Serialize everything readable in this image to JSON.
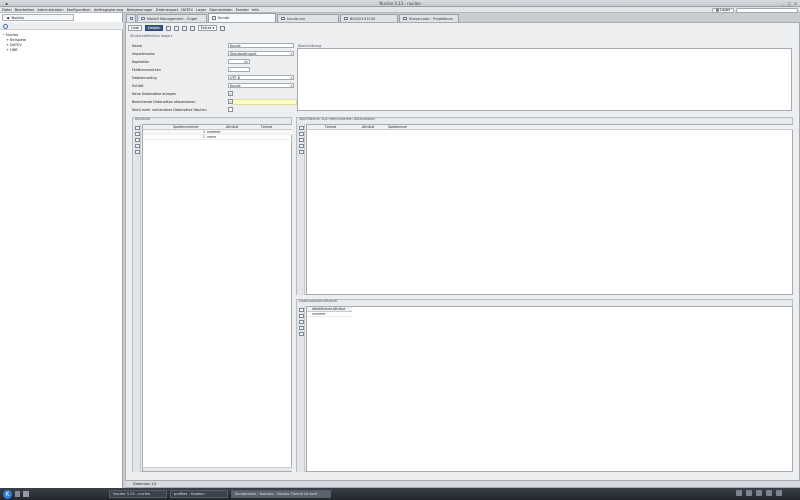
{
  "window": {
    "title": "Nucleo 3.13 - nucleo",
    "controls": [
      "_",
      "□",
      "×"
    ]
  },
  "menu": [
    "Datei",
    "Bearbeiten",
    "Administration",
    "Konfiguration",
    "Auftragsplanung",
    "Belegmanager",
    "Datenexport",
    "DATEV",
    "Lager",
    "Stammdaten",
    "Fenster",
    "Info"
  ],
  "lager_button": "Lager",
  "left_pane": {
    "tab_label": "Nucleo",
    "tree": [
      {
        "label": "Nucleo",
        "level": 0,
        "expander": "−"
      },
      {
        "label": "Beispiele",
        "level": 1,
        "expander": "+"
      },
      {
        "label": "DATEV",
        "level": 1,
        "expander": "+"
      },
      {
        "label": "HBR",
        "level": 1,
        "expander": "+"
      }
    ]
  },
  "tabs": [
    {
      "label": "",
      "active": false
    },
    {
      "label": "Modell Management - Engel",
      "active": false
    },
    {
      "label": "Kunde",
      "active": true
    },
    {
      "label": "kunde.csv",
      "active": false
    },
    {
      "label": "80020191230",
      "active": false
    },
    {
      "label": "Steuercode - Projektions",
      "active": false
    }
  ],
  "toolbar": {
    "btn_liste": "Liste",
    "btn_details": "Details",
    "extras": "Extras ▾"
  },
  "section_title": "Strukturdefinition Import",
  "form": [
    {
      "label": "Name",
      "value": "Kunde",
      "type": "text"
    },
    {
      "label": "Importmodus",
      "value": "Standardimport",
      "type": "select"
    },
    {
      "label": "Kopfzeilen",
      "value": "1",
      "type": "spin"
    },
    {
      "label": "Feldtrennzeichen",
      "value": ";",
      "type": "small"
    },
    {
      "label": "Dateiencoding",
      "value": "UTF-8",
      "type": "select"
    },
    {
      "label": "Entität",
      "value": "Kunde",
      "type": "select"
    },
    {
      "label": "Neue Datensätze anlegen",
      "value": "✓",
      "type": "check"
    },
    {
      "label": "Bestehende Datensätze aktualisieren",
      "value": "✓",
      "type": "check"
    },
    {
      "label": "Nicht mehr vorhandene Datensätze löschen",
      "value": "",
      "type": "check"
    }
  ],
  "beschreibung_title": "Beschreibung",
  "attribute": {
    "title": "Attribute",
    "columns": [
      "Spaltennummer",
      "Attribut",
      "Format"
    ],
    "rows": [
      {
        "nr": "1",
        "attr": "nummer",
        "fmt": ""
      },
      {
        "nr": "2",
        "attr": "name",
        "fmt": ""
      }
    ]
  },
  "identifiers": {
    "title": "Identifizierer aus referenzierten Datensätzen",
    "columns": [
      "Format",
      "Attribut",
      "Spaltennum"
    ]
  },
  "datensatz": {
    "title": "Datensatzidentifizierer",
    "columns": [
      "Identifizierer-Attribut"
    ],
    "rows": [
      "nummer"
    ]
  },
  "status": "Datensatz 1/1",
  "taskbar": {
    "tasks": [
      {
        "label": "Nucleo 3.13 - nucleo",
        "active": false
      },
      {
        "label": "profiles - Dolphin",
        "active": false
      },
      {
        "label": "Kundenliste - Konsole - Nucleo Theme ist konf",
        "active": true
      }
    ]
  },
  "colors": {
    "accent": "#3c5a85",
    "highlight": "#fdfcc8"
  }
}
